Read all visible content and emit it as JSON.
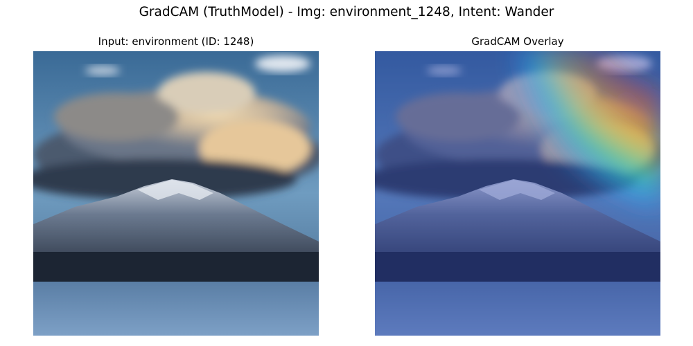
{
  "figure": {
    "title": "GradCAM (TruthModel) - Img: environment_1248, Intent: Wander"
  },
  "panels": {
    "input": {
      "title": "Input: environment (ID: 1248)",
      "image_content": "photo of a snow-dusted mountain under a large sunlit cloud above a frozen lake"
    },
    "overlay": {
      "title": "GradCAM Overlay",
      "image_content": "same photo with a jet-colormap heatmap; strongest activation at the upper-right cloud region"
    }
  },
  "colors": {
    "sky_top": "#3f6f9c",
    "sky_mid": "#7aa3c4",
    "cloud_light": "#e8d7b8",
    "cloud_dark": "#4f5f72",
    "mountain_dark": "#2a3446",
    "snow": "#c9d2de",
    "lake": "#6d8fb3",
    "heat_hot": "#ff3b1f",
    "heat_warm": "#ffd21a",
    "heat_mid": "#3de07a",
    "heat_cool": "#2aa8ff"
  }
}
